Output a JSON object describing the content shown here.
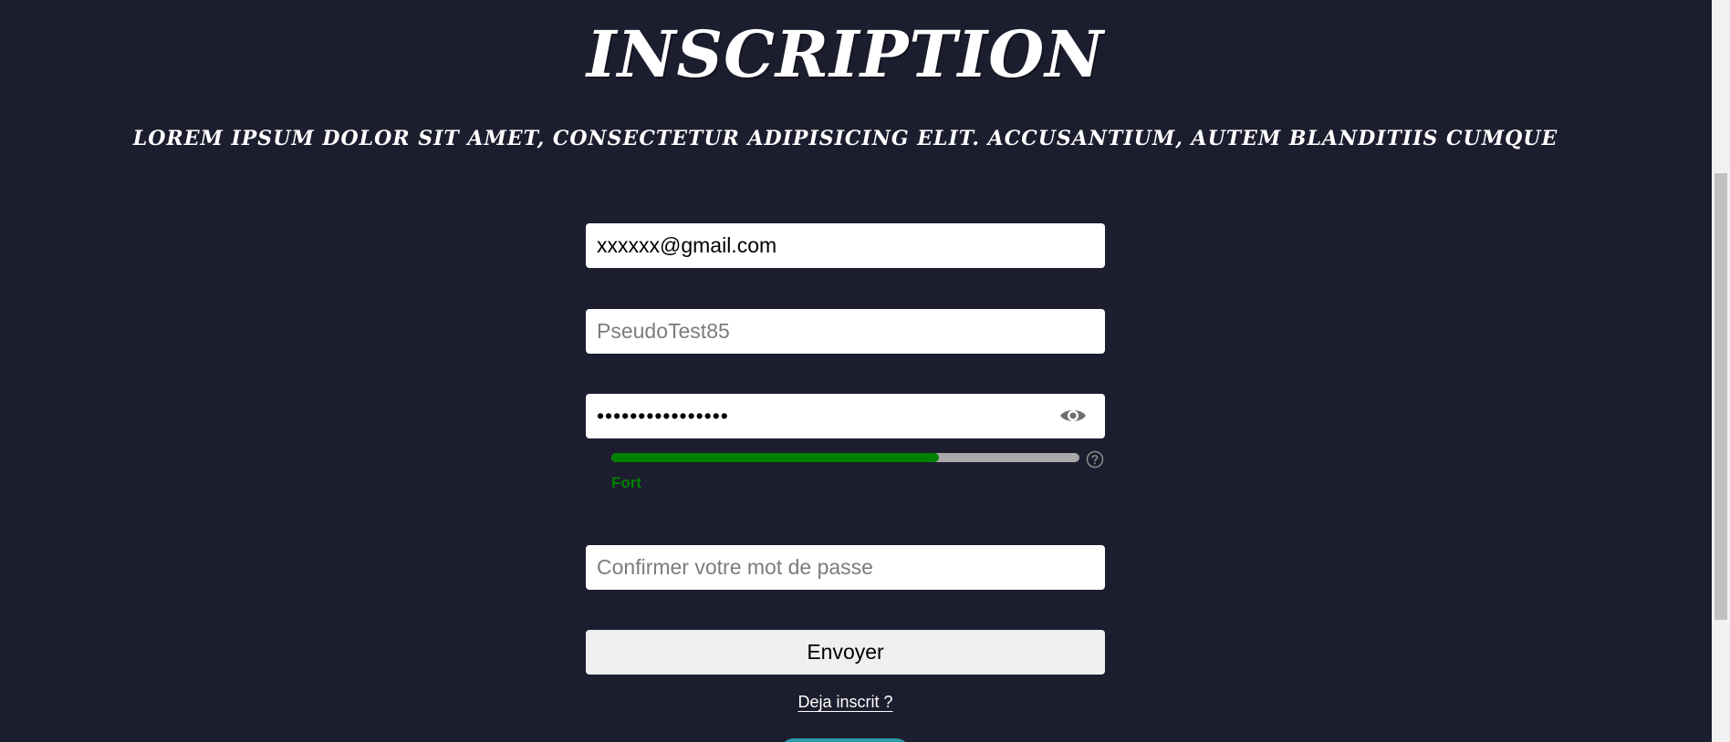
{
  "header": {
    "title": "INSCRIPTION",
    "subtitle": "Lorem ipsum dolor sit amet, consectetur adipisicing elit. Accusantium, autem blanditiis cumque"
  },
  "form": {
    "email": {
      "value": "xxxxxx@gmail.com",
      "placeholder": ""
    },
    "pseudo": {
      "value": "",
      "placeholder": "PseudoTest85"
    },
    "password": {
      "value": "mypassword12345!",
      "placeholder": "",
      "toggle_icon": "eye-icon"
    },
    "strength": {
      "level": 0.7,
      "label": "Fort",
      "color": "#008000",
      "help_icon": "question-circle-icon"
    },
    "confirm": {
      "value": "",
      "placeholder": "Confirmer votre mot de passe"
    },
    "submit_label": "Envoyer",
    "login_link": "Deja inscrit ?"
  },
  "colors": {
    "background": "#1c1d2e",
    "accent_button": "#2c9aa5"
  }
}
